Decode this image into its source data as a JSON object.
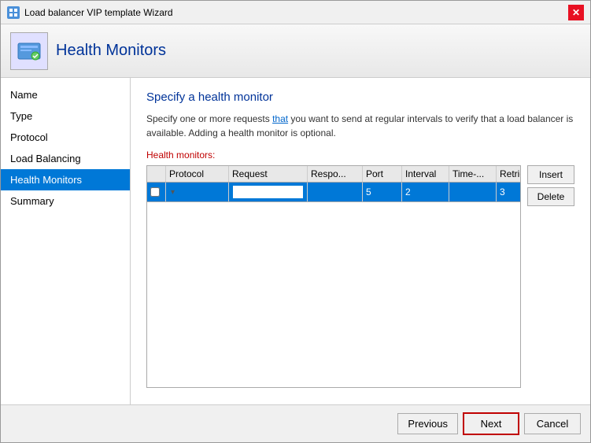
{
  "window": {
    "title": "Load balancer VIP template Wizard",
    "close_label": "✕"
  },
  "header": {
    "title": "Health Monitors",
    "icon_label": "HM"
  },
  "sidebar": {
    "items": [
      {
        "id": "name",
        "label": "Name",
        "active": false
      },
      {
        "id": "type",
        "label": "Type",
        "active": false
      },
      {
        "id": "protocol",
        "label": "Protocol",
        "active": false
      },
      {
        "id": "load-balancing",
        "label": "Load Balancing",
        "active": false
      },
      {
        "id": "health-monitors",
        "label": "Health Monitors",
        "active": true
      },
      {
        "id": "summary",
        "label": "Summary",
        "active": false
      }
    ]
  },
  "content": {
    "section_title": "Specify a health monitor",
    "description_part1": "Specify one or more requests ",
    "description_link": "that",
    "description_part2": " you want to send at regular intervals to verify that a load balancer is available. Adding a health monitor is optional.",
    "monitors_label": "Health monitors:",
    "table": {
      "columns": [
        "",
        "Protocol",
        "Request",
        "Respo...",
        "Port",
        "Interval",
        "Time-...",
        "Retries"
      ],
      "row": {
        "checkbox": "",
        "protocol": "",
        "dropdown_arrow": "▾",
        "request": "",
        "response": "",
        "port": "5",
        "interval": "2",
        "timeout": "",
        "retries": "3"
      }
    },
    "buttons": {
      "insert": "Insert",
      "delete": "Delete"
    }
  },
  "footer": {
    "previous_label": "Previous",
    "next_label": "Next",
    "cancel_label": "Cancel"
  }
}
